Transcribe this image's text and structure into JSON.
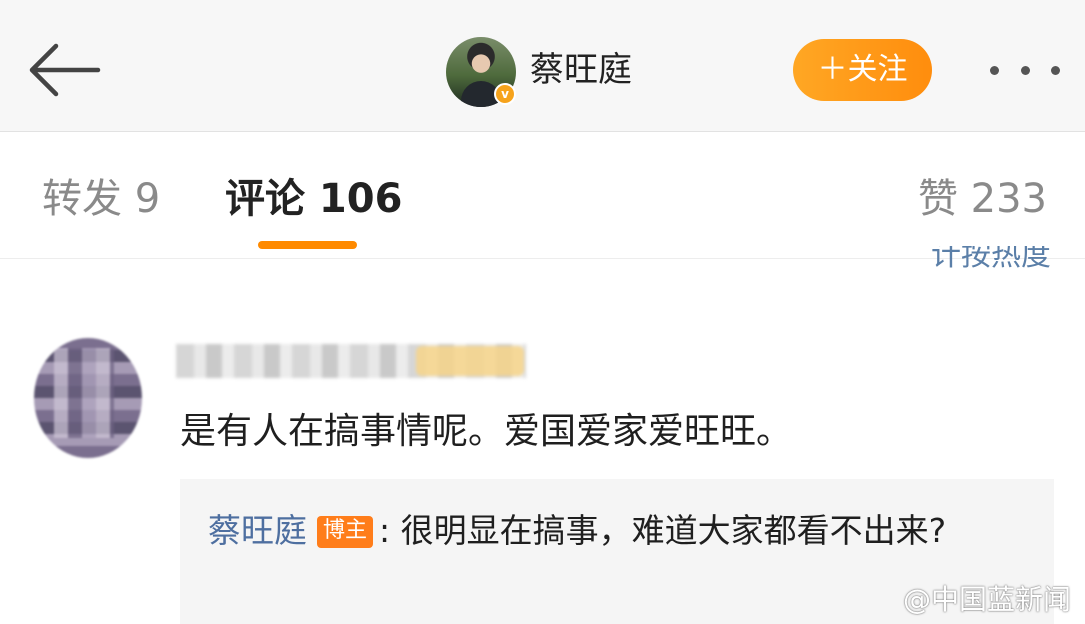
{
  "header": {
    "back_icon": "arrow-left-icon",
    "author_name": "蔡旺庭",
    "verified_badge": "v",
    "follow_label": "＋关注",
    "more_icon": "more-dots-icon"
  },
  "tabs": [
    {
      "label": "转发 9"
    },
    {
      "label": "评论 106"
    },
    {
      "label": "赞 233"
    }
  ],
  "sort_label": "计按热度",
  "comment": {
    "text": "是有人在搞事情呢。爱国爱家爱旺旺。",
    "reply": {
      "author": "蔡旺庭",
      "tag": "博主",
      "text": ": 很明显在搞事，难道大家都看不出来?"
    }
  },
  "watermark": "@中国蓝新闻",
  "colors": {
    "accent": "#ff8a00",
    "link": "#4e6fa0",
    "tag": "#ff7d1a"
  }
}
